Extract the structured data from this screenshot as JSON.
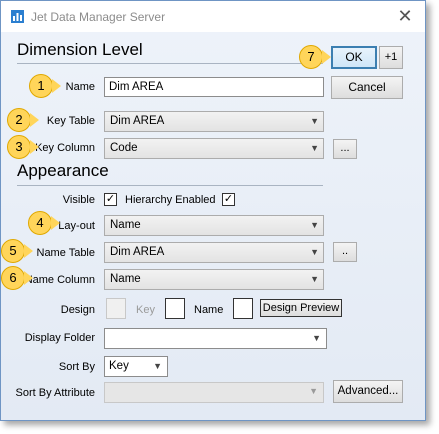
{
  "window": {
    "title": "Jet Data Manager Server",
    "close_glyph": "✕"
  },
  "dimension_level": {
    "heading": "Dimension Level",
    "name_label": "Name",
    "name_value": "Dim AREA",
    "key_table_label": "Key Table",
    "key_table_value": "Dim AREA",
    "key_column_label": "Key Column",
    "key_column_value": "Code",
    "key_column_browse": "..."
  },
  "buttons": {
    "ok": "OK",
    "plus_one": "+1",
    "cancel": "Cancel",
    "advanced": "Advanced..."
  },
  "appearance": {
    "heading": "Appearance",
    "visible_label": "Visible",
    "visible_checked": "✓",
    "hierarchy_label": "Hierarchy Enabled",
    "hierarchy_checked": "✓",
    "layout_label": "Lay-out",
    "layout_value": "Name",
    "name_table_label": "Name Table",
    "name_table_value": "Dim AREA",
    "name_table_browse": "..",
    "name_column_label": "Name Column",
    "name_column_value": "Name",
    "design_label": "Design",
    "design_key_label": "Key",
    "design_name_label": "Name",
    "design_preview": "Design Preview",
    "display_folder_label": "Display Folder",
    "display_folder_value": "",
    "sort_by_label": "Sort By",
    "sort_by_value": "Key",
    "sort_by_attribute_label": "Sort By Attribute",
    "sort_by_attribute_value": ""
  },
  "callouts": [
    "1",
    "2",
    "3",
    "4",
    "5",
    "6",
    "7"
  ],
  "colors": {
    "callout_fill": "#ffd55a",
    "ok_border": "#3c7fb1",
    "window_bg": "#e3eaf4"
  }
}
